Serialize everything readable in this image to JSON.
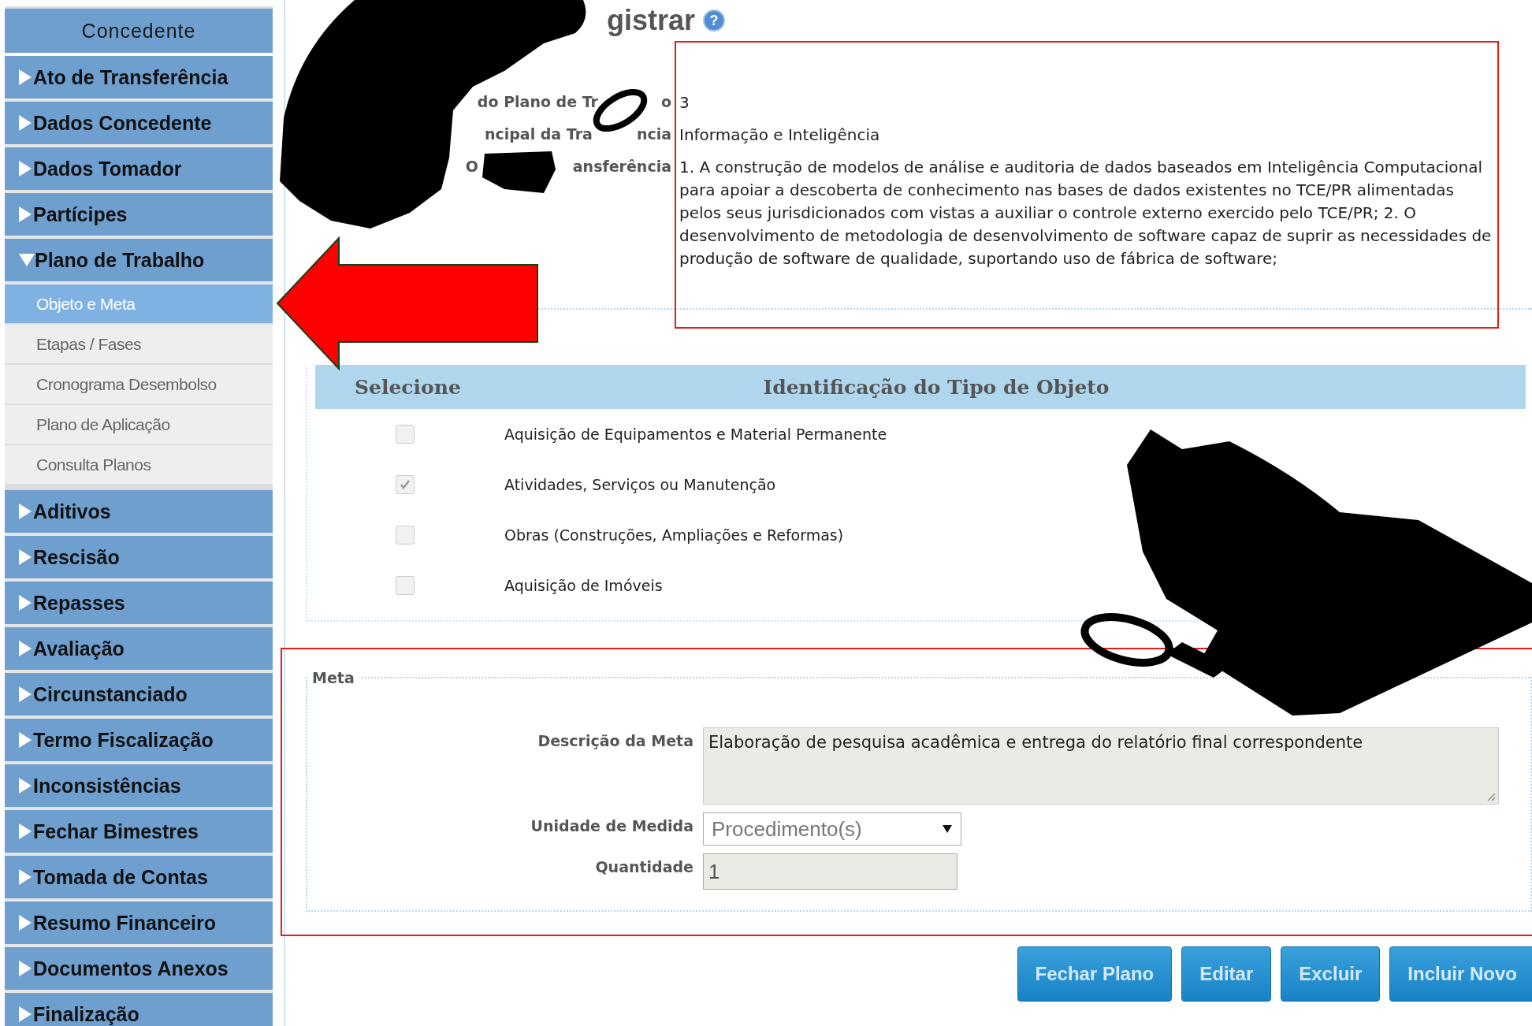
{
  "sidebar": {
    "title": "Concedente",
    "items": [
      {
        "label": "Ato de Transferência",
        "expanded": false
      },
      {
        "label": "Dados Concedente",
        "expanded": false
      },
      {
        "label": "Dados Tomador",
        "expanded": false
      },
      {
        "label": "Partícipes",
        "expanded": false
      },
      {
        "label": "Plano de Trabalho",
        "expanded": true,
        "children": [
          {
            "label": "Objeto e Meta",
            "selected": true
          },
          {
            "label": "Etapas / Fases",
            "selected": false
          },
          {
            "label": "Cronograma Desembolso",
            "selected": false
          },
          {
            "label": "Plano de Aplicação",
            "selected": false
          },
          {
            "label": "Consulta Planos",
            "selected": false
          }
        ]
      },
      {
        "label": "Aditivos",
        "expanded": false
      },
      {
        "label": "Rescisão",
        "expanded": false
      },
      {
        "label": "Repasses",
        "expanded": false
      },
      {
        "label": "Avaliação",
        "expanded": false
      },
      {
        "label": "Circunstanciado",
        "expanded": false
      },
      {
        "label": "Termo Fiscalização",
        "expanded": false
      },
      {
        "label": "Inconsistências",
        "expanded": false
      },
      {
        "label": "Fechar Bimestres",
        "expanded": false
      },
      {
        "label": "Tomada de Contas",
        "expanded": false
      },
      {
        "label": "Resumo Financeiro",
        "expanded": false
      },
      {
        "label": "Documentos Anexos",
        "expanded": false
      },
      {
        "label": "Finalização",
        "expanded": false
      }
    ]
  },
  "page_title": "gistrar",
  "help_label": "?",
  "details": [
    {
      "label_parts": [
        "do Plano de Tr",
        "o"
      ],
      "value": "3"
    },
    {
      "label_parts": [
        "ncipal da Tra",
        "ncia"
      ],
      "value": "Informação e Inteligência"
    },
    {
      "label_parts": [
        "O",
        "ansferência"
      ],
      "value": "1. A construção de modelos de análise e auditoria de dados baseados em Inteligência Computacional para apoiar a descoberta de conhecimento nas bases de dados existentes no TCE/PR alimentadas pelos seus jurisdicionados com vistas a auxiliar o controle externo exercido pelo TCE/PR; 2. O desenvolvimento de metodologia de desenvolvimento de software capaz de suprir as necessidades de produção de software de qualidade, suportando uso de fábrica de software;"
    }
  ],
  "object_types": {
    "columns": [
      "Selecione",
      "Identificação do Tipo de Objeto"
    ],
    "rows": [
      {
        "label": "Aquisição de Equipamentos e Material Permanente",
        "checked": false
      },
      {
        "label": "Atividades, Serviços ou Manutenção",
        "checked": true
      },
      {
        "label": "Obras (Construções, Ampliações e Reformas)",
        "checked": false
      },
      {
        "label": "Aquisição de Imóveis",
        "checked": false
      }
    ]
  },
  "meta": {
    "legend": "Meta",
    "fields": [
      {
        "kind": "textarea",
        "label": "Descrição da Meta",
        "value": "Elaboração de pesquisa acadêmica e entrega do relatório final correspondente"
      },
      {
        "kind": "select",
        "label": "Unidade de Medida",
        "value": "Procedimento(s)"
      },
      {
        "kind": "input",
        "label": "Quantidade",
        "value": "1"
      }
    ]
  },
  "buttons": [
    "Fechar Plano",
    "Editar",
    "Excluir",
    "Incluir Novo"
  ]
}
